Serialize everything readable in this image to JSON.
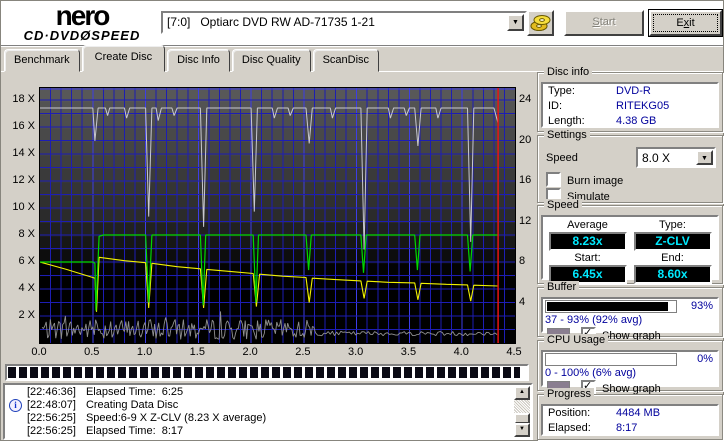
{
  "window": {
    "logo_line1": "nero",
    "logo_line2_left": "CD·DVD",
    "logo_disc": "Ø",
    "logo_line2_right": "SPEED",
    "drive_select": "[7:0]   Optiarc DVD RW AD-71735 1-21",
    "eject_icon": "disc-stack-icon",
    "start_button": {
      "pre": "",
      "u": "S",
      "post": "tart"
    },
    "exit_button": {
      "pre": "E",
      "u": "x",
      "post": "it"
    }
  },
  "tabs": [
    {
      "label": "Benchmark",
      "active": false
    },
    {
      "label": "Create Disc",
      "active": true
    },
    {
      "label": "Disc Info",
      "active": false
    },
    {
      "label": "Disc Quality",
      "active": false
    },
    {
      "label": "ScanDisc",
      "active": false
    }
  ],
  "chart_data": {
    "type": "line",
    "x_ticks": [
      "0.0",
      "0.5",
      "1.0",
      "1.5",
      "2.0",
      "2.5",
      "3.0",
      "3.5",
      "4.0",
      "4.5"
    ],
    "x_range": [
      0,
      4.5
    ],
    "y_left_ticks": [
      "18 X",
      "16 X",
      "14 X",
      "12 X",
      "10 X",
      "8 X",
      "6 X",
      "4 X",
      "2 X"
    ],
    "y_left_range": [
      0,
      18.9
    ],
    "y_right_ticks": [
      "24",
      "20",
      "16",
      "12",
      "8",
      "4"
    ],
    "y_right_range": [
      0,
      25.2
    ],
    "grid": true,
    "grid_color": "#1d1db4",
    "grid_major_color": "#3d3de8",
    "marker_color": "#e81414",
    "position_marker_x": 4.34,
    "series": [
      {
        "name": "cpu-usage",
        "color": "#909090",
        "axis": "percent",
        "width": 0.9,
        "generator": {
          "seed": 7,
          "segments": [
            {
              "from": 0.02,
              "to": 2.6,
              "step": 0.013,
              "base": 4.2,
              "amp": 8,
              "spike_p": 0.05,
              "spike_amp": 10
            },
            {
              "from": 2.61,
              "to": 4.34,
              "step": 0.02,
              "base": 3.5,
              "amp": 1.8,
              "spike_p": 0,
              "spike_amp": 0
            }
          ]
        }
      },
      {
        "name": "buffer-level",
        "color": "#c8c8d0",
        "axis": "percent",
        "width": 1,
        "points": [
          [
            0,
            93
          ],
          [
            0.5,
            93
          ],
          [
            0.52,
            80
          ],
          [
            0.55,
            93
          ],
          [
            0.62,
            93
          ],
          [
            0.64,
            90
          ],
          [
            0.66,
            93
          ],
          [
            0.8,
            93
          ],
          [
            0.82,
            89
          ],
          [
            0.85,
            93
          ],
          [
            1.0,
            93
          ],
          [
            1.03,
            50
          ],
          [
            1.06,
            93
          ],
          [
            1.1,
            93
          ],
          [
            1.12,
            88
          ],
          [
            1.15,
            93
          ],
          [
            1.25,
            93
          ],
          [
            1.27,
            90
          ],
          [
            1.3,
            93
          ],
          [
            1.52,
            93
          ],
          [
            1.55,
            46
          ],
          [
            1.58,
            93
          ],
          [
            2.0,
            93
          ],
          [
            2.03,
            52
          ],
          [
            2.06,
            93
          ],
          [
            2.2,
            93
          ],
          [
            2.22,
            89
          ],
          [
            2.25,
            93
          ],
          [
            2.35,
            93
          ],
          [
            2.37,
            90
          ],
          [
            2.4,
            93
          ],
          [
            2.52,
            93
          ],
          [
            2.55,
            79
          ],
          [
            2.58,
            93
          ],
          [
            2.75,
            93
          ],
          [
            2.77,
            89
          ],
          [
            2.8,
            93
          ],
          [
            3.04,
            93
          ],
          [
            3.07,
            37
          ],
          [
            3.1,
            93
          ],
          [
            3.3,
            93
          ],
          [
            3.32,
            89
          ],
          [
            3.35,
            93
          ],
          [
            3.45,
            93
          ],
          [
            3.47,
            90
          ],
          [
            3.5,
            93
          ],
          [
            3.55,
            93
          ],
          [
            3.58,
            78
          ],
          [
            3.61,
            93
          ],
          [
            3.75,
            93
          ],
          [
            3.77,
            89
          ],
          [
            3.8,
            93
          ],
          [
            4.05,
            93
          ],
          [
            4.08,
            40
          ],
          [
            4.11,
            93
          ],
          [
            4.3,
            93
          ],
          [
            4.34,
            87
          ]
        ]
      },
      {
        "name": "secondary-speed",
        "color": "#f2f200",
        "axis": "left",
        "width": 1.1,
        "points": [
          [
            0,
            6.0
          ],
          [
            0.25,
            5.45
          ],
          [
            0.5,
            4.85
          ],
          [
            0.52,
            4.8
          ],
          [
            0.535,
            2.3
          ],
          [
            0.56,
            6.35
          ],
          [
            0.8,
            6.1
          ],
          [
            1.0,
            5.95
          ],
          [
            1.03,
            2.6
          ],
          [
            1.06,
            5.9
          ],
          [
            1.3,
            5.65
          ],
          [
            1.52,
            5.5
          ],
          [
            1.55,
            2.6
          ],
          [
            1.58,
            5.45
          ],
          [
            1.8,
            5.3
          ],
          [
            2.02,
            5.15
          ],
          [
            2.05,
            2.7
          ],
          [
            2.08,
            5.1
          ],
          [
            2.3,
            4.95
          ],
          [
            2.52,
            4.85
          ],
          [
            2.55,
            3.0
          ],
          [
            2.58,
            4.8
          ],
          [
            2.8,
            4.7
          ],
          [
            3.04,
            4.6
          ],
          [
            3.07,
            3.3
          ],
          [
            3.1,
            4.58
          ],
          [
            3.3,
            4.5
          ],
          [
            3.55,
            4.45
          ],
          [
            3.58,
            3.2
          ],
          [
            3.61,
            4.42
          ],
          [
            3.85,
            4.35
          ],
          [
            4.05,
            4.3
          ],
          [
            4.08,
            3.1
          ],
          [
            4.11,
            4.28
          ],
          [
            4.34,
            4.22
          ]
        ]
      },
      {
        "name": "write-speed",
        "color": "#00d800",
        "axis": "left",
        "width": 1.2,
        "points": [
          [
            0,
            6
          ],
          [
            0.5,
            6
          ],
          [
            0.52,
            5.9
          ],
          [
            0.53,
            2.4
          ],
          [
            0.56,
            7.9
          ],
          [
            0.6,
            8
          ],
          [
            1.0,
            8
          ],
          [
            1.03,
            3.0
          ],
          [
            1.06,
            8
          ],
          [
            1.52,
            8
          ],
          [
            1.545,
            2.8
          ],
          [
            1.57,
            8
          ],
          [
            2.02,
            8
          ],
          [
            2.045,
            3.0
          ],
          [
            2.07,
            8
          ],
          [
            2.52,
            8
          ],
          [
            2.545,
            5.4
          ],
          [
            2.57,
            8
          ],
          [
            3.04,
            8
          ],
          [
            3.065,
            5.2
          ],
          [
            3.09,
            8
          ],
          [
            3.55,
            8
          ],
          [
            3.575,
            5.4
          ],
          [
            3.6,
            8
          ],
          [
            4.05,
            8
          ],
          [
            4.075,
            5.3
          ],
          [
            4.1,
            8
          ],
          [
            4.34,
            8
          ]
        ]
      }
    ]
  },
  "progress_bar": {
    "percent": 98.5
  },
  "log": {
    "entries": [
      {
        "time": "[22:46:36]",
        "text": "Elapsed Time:  6:25",
        "icon": false
      },
      {
        "time": "[22:48:07]",
        "text": "Creating Data Disc",
        "icon": true
      },
      {
        "time": "[22:56:25]",
        "text": "Speed:6-9 X Z-CLV (8.23 X average)",
        "icon": false
      },
      {
        "time": "[22:56:25]",
        "text": "Elapsed Time:  8:17",
        "icon": false
      }
    ]
  },
  "panels": {
    "disc_info": {
      "title": "Disc info",
      "rows": [
        {
          "label": "Type:",
          "value": "DVD-R"
        },
        {
          "label": "ID:",
          "value": "RITEKG05"
        },
        {
          "label": "Length:",
          "value": "4.38 GB"
        }
      ]
    },
    "settings": {
      "title": "Settings",
      "speed_label": "Speed",
      "speed_value": "8.0 X",
      "checkboxes": [
        {
          "label": "Burn image",
          "checked": false
        },
        {
          "label": "Simulate",
          "checked": false
        }
      ]
    },
    "speed": {
      "title": "Speed",
      "cells": [
        {
          "header": "Average",
          "value": "8.23x"
        },
        {
          "header": "Type:",
          "value": "Z-CLV"
        },
        {
          "header": "Start:",
          "value": "6.45x"
        },
        {
          "header": "End:",
          "value": "8.60x"
        }
      ]
    },
    "buffer": {
      "title": "Buffer",
      "bar_percent": 93,
      "bar_label": "93%",
      "range_text": "37 - 93% (92% avg)",
      "show_graph": "Show graph",
      "checked": true,
      "swatch": "#8a7e90"
    },
    "cpu": {
      "title": "CPU Usage",
      "bar_percent": 0,
      "bar_label": "0%",
      "range_text": "0 - 100% (6% avg)",
      "show_graph": "Show graph",
      "checked": true,
      "swatch": "#8a7e90"
    },
    "progress": {
      "title": "Progress",
      "rows": [
        {
          "label": "Position:",
          "value": "4484 MB"
        },
        {
          "label": "Elapsed:",
          "value": "8:17"
        }
      ]
    }
  }
}
